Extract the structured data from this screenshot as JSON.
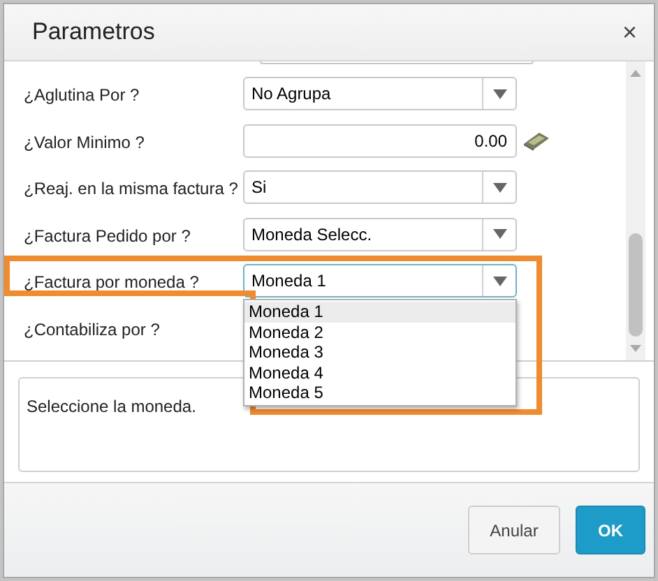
{
  "window": {
    "title": "Parametros",
    "close": "×"
  },
  "rows": [
    {
      "kind": "select",
      "label": "¿Aglutina Por ?",
      "value": "No Agrupa",
      "open": false
    },
    {
      "kind": "number",
      "label": "¿Valor Minimo ?",
      "value": "0.00"
    },
    {
      "kind": "select",
      "label": "¿Reaj. en la misma factura ?",
      "value": "Si",
      "open": false
    },
    {
      "kind": "select",
      "label": "¿Factura Pedido por ?",
      "value": "Moneda Selecc.",
      "open": false
    },
    {
      "kind": "select",
      "label": "¿Factura por moneda ?",
      "value": "Moneda 1",
      "open": true,
      "highlighted": true,
      "options": [
        {
          "label": "Moneda 1",
          "selected": true
        },
        {
          "label": "Moneda 2",
          "selected": false
        },
        {
          "label": "Moneda 3",
          "selected": false
        },
        {
          "label": "Moneda 4",
          "selected": false
        },
        {
          "label": "Moneda 5",
          "selected": false
        }
      ]
    },
    {
      "kind": "label",
      "label": "¿Contabiliza por ?"
    }
  ],
  "help": "Seleccione la moneda.",
  "buttons": [
    {
      "label": "Anular",
      "kind": "secondary"
    },
    {
      "label": "OK",
      "kind": "primary"
    }
  ]
}
